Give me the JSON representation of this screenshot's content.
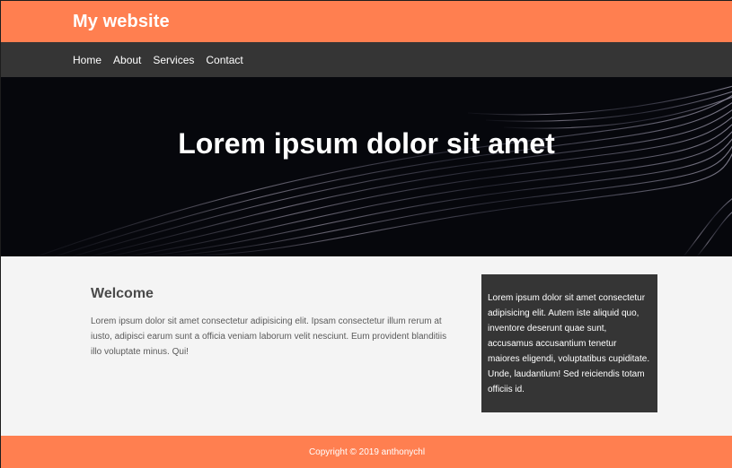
{
  "header": {
    "title": "My website"
  },
  "nav": {
    "items": [
      {
        "label": "Home"
      },
      {
        "label": "About"
      },
      {
        "label": "Services"
      },
      {
        "label": "Contact"
      }
    ]
  },
  "hero": {
    "title": "Lorem ipsum dolor sit amet"
  },
  "welcome": {
    "heading": "Welcome",
    "text": "Lorem ipsum dolor sit amet consectetur adipisicing elit. Ipsam consectetur illum rerum at iusto, adipisci earum sunt a officia veniam laborum velit nesciunt. Eum provident blanditiis illo voluptate minus. Qui!"
  },
  "sidebar": {
    "text": "Lorem ipsum dolor sit amet consectetur adipisicing elit. Autem iste aliquid quo, inventore deserunt quae sunt, accusamus accusantium tenetur maiores eligendi, voluptatibus cupiditate. Unde, laudantium! Sed reiciendis totam officiis id."
  },
  "footer": {
    "copyright": "Copyright © 2019 anthonychl"
  },
  "colors": {
    "accent": "#ff7f50",
    "nav_bg": "#353535",
    "hero_bg": "#06070c",
    "page_bg": "#f4f4f4"
  }
}
